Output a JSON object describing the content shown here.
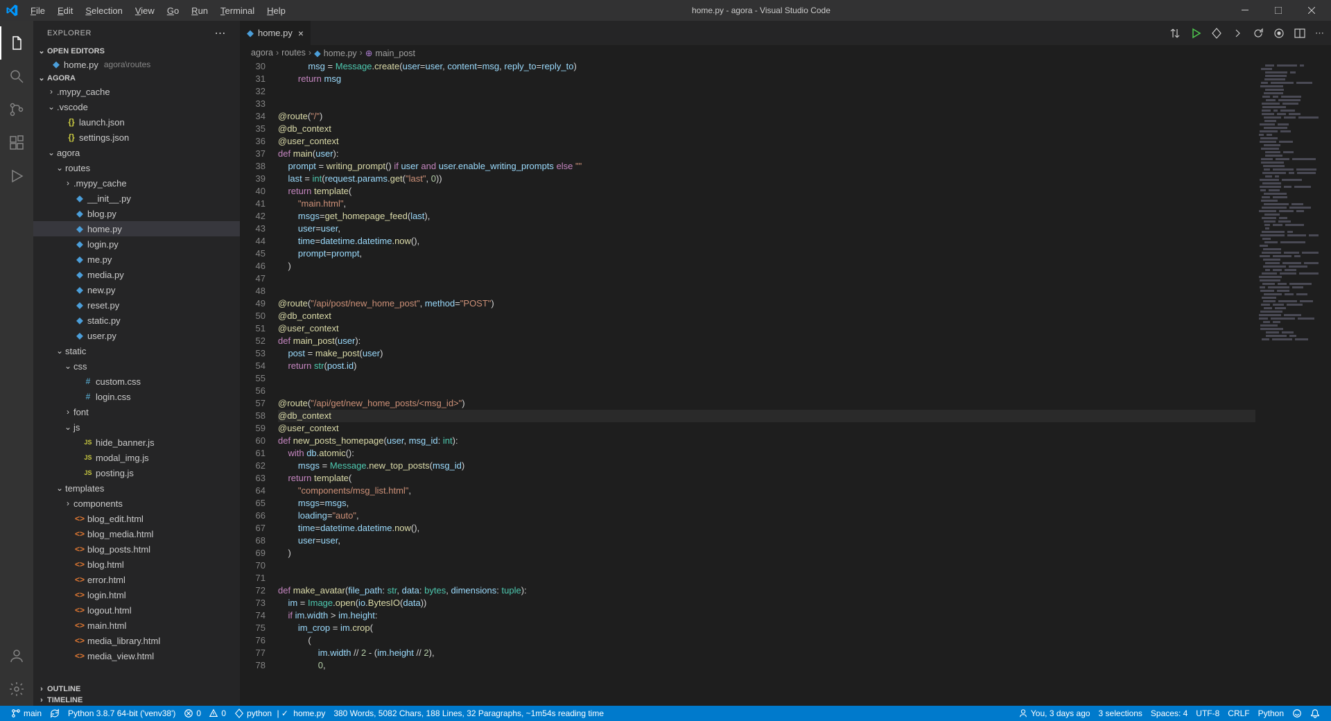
{
  "title": "home.py - agora - Visual Studio Code",
  "menu": [
    "File",
    "Edit",
    "Selection",
    "View",
    "Go",
    "Run",
    "Terminal",
    "Help"
  ],
  "sidebar": {
    "header": "EXPLORER",
    "open_editors_label": "OPEN EDITORS",
    "open_editors": [
      {
        "name": "home.py",
        "path": "agora\\routes",
        "icon": "py"
      }
    ],
    "workspace_label": "AGORA",
    "tree": [
      {
        "depth": 0,
        "type": "folder",
        "chev": ">",
        "name": ".mypy_cache"
      },
      {
        "depth": 0,
        "type": "folder",
        "chev": "v",
        "name": ".vscode"
      },
      {
        "depth": 1,
        "type": "file",
        "icon": "json",
        "g": "{}",
        "name": "launch.json"
      },
      {
        "depth": 1,
        "type": "file",
        "icon": "json",
        "g": "{}",
        "name": "settings.json"
      },
      {
        "depth": 0,
        "type": "folder",
        "chev": "v",
        "name": "agora"
      },
      {
        "depth": 1,
        "type": "folder",
        "chev": "v",
        "name": "routes"
      },
      {
        "depth": 2,
        "type": "folder",
        "chev": ">",
        "name": ".mypy_cache"
      },
      {
        "depth": 2,
        "type": "file",
        "icon": "py",
        "g": "◆",
        "name": "__init__.py"
      },
      {
        "depth": 2,
        "type": "file",
        "icon": "py",
        "g": "◆",
        "name": "blog.py"
      },
      {
        "depth": 2,
        "type": "file",
        "icon": "py",
        "g": "◆",
        "name": "home.py",
        "active": true
      },
      {
        "depth": 2,
        "type": "file",
        "icon": "py",
        "g": "◆",
        "name": "login.py"
      },
      {
        "depth": 2,
        "type": "file",
        "icon": "py",
        "g": "◆",
        "name": "me.py"
      },
      {
        "depth": 2,
        "type": "file",
        "icon": "py",
        "g": "◆",
        "name": "media.py"
      },
      {
        "depth": 2,
        "type": "file",
        "icon": "py",
        "g": "◆",
        "name": "new.py"
      },
      {
        "depth": 2,
        "type": "file",
        "icon": "py",
        "g": "◆",
        "name": "reset.py"
      },
      {
        "depth": 2,
        "type": "file",
        "icon": "py",
        "g": "◆",
        "name": "static.py"
      },
      {
        "depth": 2,
        "type": "file",
        "icon": "py",
        "g": "◆",
        "name": "user.py"
      },
      {
        "depth": 1,
        "type": "folder",
        "chev": "v",
        "name": "static"
      },
      {
        "depth": 2,
        "type": "folder",
        "chev": "v",
        "name": "css"
      },
      {
        "depth": 3,
        "type": "file",
        "icon": "css",
        "g": "#",
        "name": "custom.css"
      },
      {
        "depth": 3,
        "type": "file",
        "icon": "css",
        "g": "#",
        "name": "login.css"
      },
      {
        "depth": 2,
        "type": "folder",
        "chev": ">",
        "name": "font"
      },
      {
        "depth": 2,
        "type": "folder",
        "chev": "v",
        "name": "js"
      },
      {
        "depth": 3,
        "type": "file",
        "icon": "js",
        "g": "JS",
        "name": "hide_banner.js"
      },
      {
        "depth": 3,
        "type": "file",
        "icon": "js",
        "g": "JS",
        "name": "modal_img.js"
      },
      {
        "depth": 3,
        "type": "file",
        "icon": "js",
        "g": "JS",
        "name": "posting.js"
      },
      {
        "depth": 1,
        "type": "folder",
        "chev": "v",
        "name": "templates"
      },
      {
        "depth": 2,
        "type": "folder",
        "chev": ">",
        "name": "components"
      },
      {
        "depth": 2,
        "type": "file",
        "icon": "html",
        "g": "<>",
        "name": "blog_edit.html"
      },
      {
        "depth": 2,
        "type": "file",
        "icon": "html",
        "g": "<>",
        "name": "blog_media.html"
      },
      {
        "depth": 2,
        "type": "file",
        "icon": "html",
        "g": "<>",
        "name": "blog_posts.html"
      },
      {
        "depth": 2,
        "type": "file",
        "icon": "html",
        "g": "<>",
        "name": "blog.html"
      },
      {
        "depth": 2,
        "type": "file",
        "icon": "html",
        "g": "<>",
        "name": "error.html"
      },
      {
        "depth": 2,
        "type": "file",
        "icon": "html",
        "g": "<>",
        "name": "login.html"
      },
      {
        "depth": 2,
        "type": "file",
        "icon": "html",
        "g": "<>",
        "name": "logout.html"
      },
      {
        "depth": 2,
        "type": "file",
        "icon": "html",
        "g": "<>",
        "name": "main.html"
      },
      {
        "depth": 2,
        "type": "file",
        "icon": "html",
        "g": "<>",
        "name": "media_library.html"
      },
      {
        "depth": 2,
        "type": "file",
        "icon": "html",
        "g": "<>",
        "name": "media_view.html"
      }
    ],
    "outline_label": "OUTLINE",
    "timeline_label": "TIMELINE"
  },
  "tab": {
    "name": "home.py"
  },
  "breadcrumb": [
    "agora",
    "routes",
    "home.py",
    "main_post"
  ],
  "editor": {
    "first_line": 30,
    "lines": [
      "            <span class='id'>msg</span> <span class='pl'>=</span> <span class='cls'>Message</span><span class='pl'>.</span><span class='fn'>create</span><span class='pl'>(</span><span class='id'>user</span><span class='pl'>=</span><span class='id'>user</span><span class='pl'>,</span> <span class='id'>content</span><span class='pl'>=</span><span class='id'>msg</span><span class='pl'>,</span> <span class='id'>reply_to</span><span class='pl'>=</span><span class='id'>reply_to</span><span class='pl'>)</span>",
      "        <span class='kw'>return</span> <span class='id'>msg</span>",
      "",
      "",
      "<span class='dec'>@route</span><span class='pl'>(</span><span class='st'>\"/\"</span><span class='pl'>)</span>",
      "<span class='dec'>@db_context</span>",
      "<span class='dec'>@user_context</span>",
      "<span class='kw'>def</span> <span class='fn'>main</span><span class='pl'>(</span><span class='id'>user</span><span class='pl'>):</span>",
      "    <span class='id'>prompt</span> <span class='pl'>=</span> <span class='fn'>writing_prompt</span><span class='pl'>()</span> <span class='kw'>if</span> <span class='id'>user</span> <span class='kw'>and</span> <span class='id'>user</span><span class='pl'>.</span><span class='id'>enable_writing_prompts</span> <span class='kw'>else</span> <span class='st'>\"\"</span>",
      "    <span class='id'>last</span> <span class='pl'>=</span> <span class='cls'>int</span><span class='pl'>(</span><span class='id'>request</span><span class='pl'>.</span><span class='id'>params</span><span class='pl'>.</span><span class='fn'>get</span><span class='pl'>(</span><span class='st'>\"last\"</span><span class='pl'>,</span> <span class='nm'>0</span><span class='pl'>))</span>",
      "    <span class='kw'>return</span> <span class='fn'>template</span><span class='pl'>(</span>",
      "        <span class='st'>\"main.html\"</span><span class='pl'>,</span>",
      "        <span class='id'>msgs</span><span class='pl'>=</span><span class='fn'>get_homepage_feed</span><span class='pl'>(</span><span class='id'>last</span><span class='pl'>),</span>",
      "        <span class='id'>user</span><span class='pl'>=</span><span class='id'>user</span><span class='pl'>,</span>",
      "        <span class='id'>time</span><span class='pl'>=</span><span class='id'>datetime</span><span class='pl'>.</span><span class='id'>datetime</span><span class='pl'>.</span><span class='fn'>now</span><span class='pl'>(),</span>",
      "        <span class='id'>prompt</span><span class='pl'>=</span><span class='id'>prompt</span><span class='pl'>,</span>",
      "    <span class='pl'>)</span>",
      "",
      "",
      "<span class='dec'>@route</span><span class='pl'>(</span><span class='st'>\"/api/post/new_home_post\"</span><span class='pl'>,</span> <span class='id'>method</span><span class='pl'>=</span><span class='st'>\"POST\"</span><span class='pl'>)</span>",
      "<span class='dec'>@db_context</span>",
      "<span class='dec'>@user_context</span>",
      "<span class='kw'>def</span> <span class='fn'>main_post</span><span class='pl'>(</span><span class='id'>user</span><span class='pl'>):</span>",
      "    <span class='id'>post</span> <span class='pl'>=</span> <span class='fn'>make_post</span><span class='pl'>(</span><span class='id'>user</span><span class='pl'>)</span>",
      "    <span class='kw'>return</span> <span class='cls'>str</span><span class='pl'>(</span><span class='id'>post</span><span class='pl'>.</span><span class='id'>id</span><span class='pl'>)</span>",
      "",
      "",
      "<span class='dec'>@route</span><span class='pl'>(</span><span class='st'>\"/api/get/new_home_posts/&lt;msg_id&gt;\"</span><span class='pl'>)</span>",
      "<span class='dec'>@db_context</span>",
      "<span class='dec'>@user_context</span>",
      "<span class='kw'>def</span> <span class='fn'>new_posts_homepage</span><span class='pl'>(</span><span class='id'>user</span><span class='pl'>,</span> <span class='id'>msg_id</span><span class='pl'>:</span> <span class='cls'>int</span><span class='pl'>):</span>",
      "    <span class='kw'>with</span> <span class='id'>db</span><span class='pl'>.</span><span class='fn'>atomic</span><span class='pl'>():</span>",
      "        <span class='id'>msgs</span> <span class='pl'>=</span> <span class='cls'>Message</span><span class='pl'>.</span><span class='fn'>new_top_posts</span><span class='pl'>(</span><span class='id'>msg_id</span><span class='pl'>)</span>",
      "    <span class='kw'>return</span> <span class='fn'>template</span><span class='pl'>(</span>",
      "        <span class='st'>\"components/msg_list.html\"</span><span class='pl'>,</span>",
      "        <span class='id'>msgs</span><span class='pl'>=</span><span class='id'>msgs</span><span class='pl'>,</span>",
      "        <span class='id'>loading</span><span class='pl'>=</span><span class='st'>\"auto\"</span><span class='pl'>,</span>",
      "        <span class='id'>time</span><span class='pl'>=</span><span class='id'>datetime</span><span class='pl'>.</span><span class='id'>datetime</span><span class='pl'>.</span><span class='fn'>now</span><span class='pl'>(),</span>",
      "        <span class='id'>user</span><span class='pl'>=</span><span class='id'>user</span><span class='pl'>,</span>",
      "    <span class='pl'>)</span>",
      "",
      "",
      "<span class='kw'>def</span> <span class='fn'>make_avatar</span><span class='pl'>(</span><span class='id'>file_path</span><span class='pl'>:</span> <span class='cls'>str</span><span class='pl'>,</span> <span class='id'>data</span><span class='pl'>:</span> <span class='cls'>bytes</span><span class='pl'>,</span> <span class='id'>dimensions</span><span class='pl'>:</span> <span class='cls'>tuple</span><span class='pl'>):</span>",
      "    <span class='id'>im</span> <span class='pl'>=</span> <span class='cls'>Image</span><span class='pl'>.</span><span class='fn'>open</span><span class='pl'>(</span><span class='id'>io</span><span class='pl'>.</span><span class='fn'>BytesIO</span><span class='pl'>(</span><span class='id'>data</span><span class='pl'>))</span>",
      "    <span class='kw'>if</span> <span class='id'>im</span><span class='pl'>.</span><span class='id'>width</span> <span class='pl'>&gt;</span> <span class='id'>im</span><span class='pl'>.</span><span class='id'>height</span><span class='pl'>:</span>",
      "        <span class='id'>im_crop</span> <span class='pl'>=</span> <span class='id'>im</span><span class='pl'>.</span><span class='fn'>crop</span><span class='pl'>(</span>",
      "            <span class='pl'>(</span>",
      "                <span class='id'>im</span><span class='pl'>.</span><span class='id'>width</span> <span class='pl'>//</span> <span class='nm'>2</span> <span class='pl'>- (</span><span class='id'>im</span><span class='pl'>.</span><span class='id'>height</span> <span class='pl'>//</span> <span class='nm'>2</span><span class='pl'>),</span>",
      "                <span class='nm'>0</span><span class='pl'>,</span>"
    ]
  },
  "status": {
    "branch": "main",
    "python_env": "Python 3.8.7 64-bit ('venv38')",
    "problems": "0",
    "warnings": "0",
    "kite": "python",
    "kite_file": "home.py",
    "metrics": "380 Words, 5082 Chars, 188 Lines, 32 Paragraphs, ~1m54s reading time",
    "blame": "You, 3 days ago",
    "selections": "3 selections",
    "spaces": "Spaces: 4",
    "encoding": "UTF-8",
    "eol": "CRLF",
    "language": "Python"
  }
}
